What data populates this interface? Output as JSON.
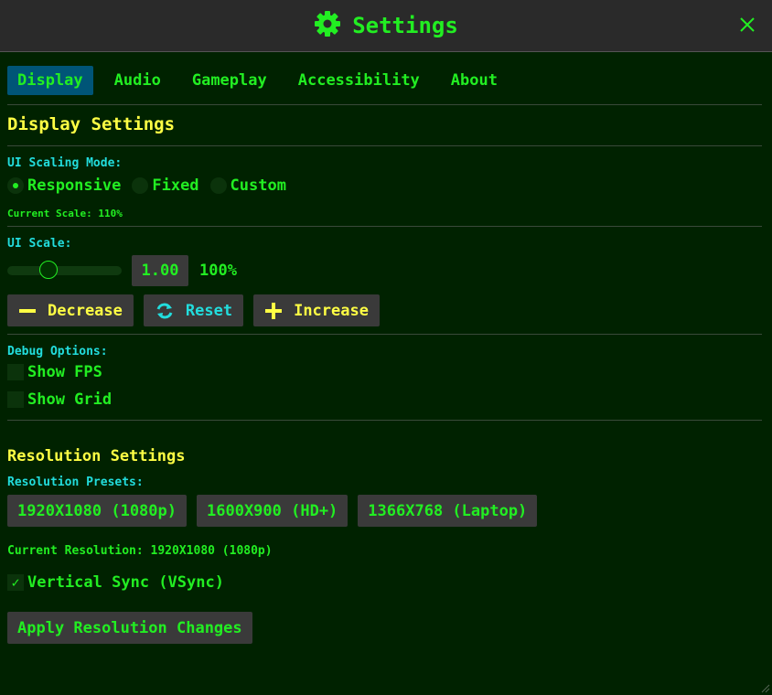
{
  "window": {
    "title": "Settings",
    "title_icon": "gear-icon",
    "close_icon": "close-icon"
  },
  "colors": {
    "accent_green": "#22ee22",
    "heading_yellow": "#ffff44",
    "label_cyan": "#22dddd",
    "active_tab": "#005577",
    "button_gray": "#3a3a3a",
    "background": "#002200"
  },
  "tabs": [
    {
      "label": "Display",
      "active": true
    },
    {
      "label": "Audio",
      "active": false
    },
    {
      "label": "Gameplay",
      "active": false
    },
    {
      "label": "Accessibility",
      "active": false
    },
    {
      "label": "About",
      "active": false
    }
  ],
  "display": {
    "title": "Display Settings",
    "scaling_mode_label": "UI Scaling Mode:",
    "scaling_modes": [
      {
        "label": "Responsive",
        "selected": true
      },
      {
        "label": "Fixed",
        "selected": false
      },
      {
        "label": "Custom",
        "selected": false
      }
    ],
    "current_scale_text": "Current Scale: 110%",
    "ui_scale_label": "UI Scale:",
    "ui_scale_value": "1.00",
    "ui_scale_percent": "100%",
    "slider_fraction": 0.33,
    "buttons": {
      "decrease": {
        "label": "Decrease",
        "icon": "minus-icon"
      },
      "reset": {
        "label": "Reset",
        "icon": "refresh-icon"
      },
      "increase": {
        "label": "Increase",
        "icon": "plus-icon"
      }
    },
    "debug_label": "Debug Options:",
    "debug_options": [
      {
        "label": "Show FPS",
        "checked": false
      },
      {
        "label": "Show Grid",
        "checked": false
      }
    ]
  },
  "resolution": {
    "title": "Resolution Settings",
    "presets_label": "Resolution Presets:",
    "presets": [
      "1920X1080 (1080p)",
      "1600X900 (HD+)",
      "1366X768 (Laptop)"
    ],
    "current_text": "Current Resolution: 1920X1080 (1080p)",
    "vsync": {
      "label": "Vertical Sync (VSync)",
      "checked": true,
      "check_glyph": "✓"
    },
    "apply_label": "Apply Resolution Changes"
  }
}
